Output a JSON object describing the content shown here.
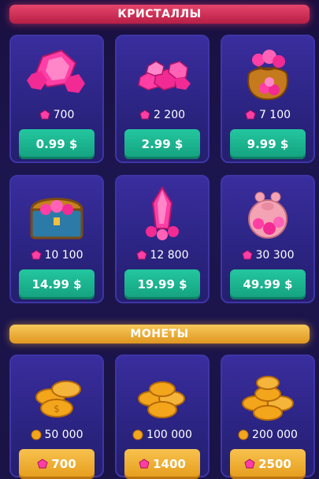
{
  "sections": {
    "crystals_title": "КРИСТАЛЛЫ",
    "coins_title": "МОНЕТЫ"
  },
  "crystal_packs": [
    {
      "amount": "700",
      "price": "0.99 $"
    },
    {
      "amount": "2 200",
      "price": "2.99 $"
    },
    {
      "amount": "7 100",
      "price": "9.99 $"
    },
    {
      "amount": "10 100",
      "price": "14.99 $"
    },
    {
      "amount": "12 800",
      "price": "19.99 $"
    },
    {
      "amount": "30 300",
      "price": "49.99 $"
    }
  ],
  "coin_packs": [
    {
      "amount": "50 000",
      "price": "700"
    },
    {
      "amount": "100 000",
      "price": "1400"
    },
    {
      "amount": "200 000",
      "price": "2500"
    }
  ],
  "colors": {
    "crystal": "#ff2f9a",
    "coin": "#f3a51b",
    "buy_green": "#1fb891",
    "buy_gold": "#f0b43a"
  }
}
